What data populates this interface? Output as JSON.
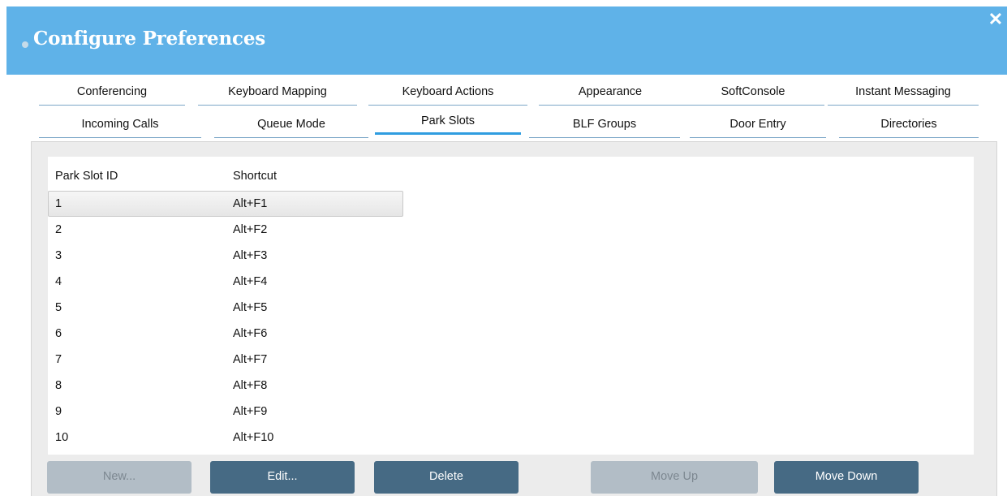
{
  "window": {
    "title": "Configure Preferences",
    "close_glyph": "✕"
  },
  "tabs_row1": [
    "Conferencing",
    "Keyboard Mapping",
    "Keyboard Actions",
    "Appearance",
    "SoftConsole",
    "Instant Messaging"
  ],
  "tabs_row2": [
    "Incoming Calls",
    "Queue Mode",
    "Park Slots",
    "BLF Groups",
    "Door Entry",
    "Directories"
  ],
  "active_tab": "Park Slots",
  "table": {
    "headers": [
      "Park Slot ID",
      "Shortcut"
    ],
    "rows": [
      [
        "1",
        "Alt+F1"
      ],
      [
        "2",
        "Alt+F2"
      ],
      [
        "3",
        "Alt+F3"
      ],
      [
        "4",
        "Alt+F4"
      ],
      [
        "5",
        "Alt+F5"
      ],
      [
        "6",
        "Alt+F6"
      ],
      [
        "7",
        "Alt+F7"
      ],
      [
        "8",
        "Alt+F8"
      ],
      [
        "9",
        "Alt+F9"
      ],
      [
        "10",
        "Alt+F10"
      ]
    ],
    "selected_row": 0
  },
  "buttons": {
    "new": {
      "label": "New...",
      "enabled": false
    },
    "edit": {
      "label": "Edit...",
      "enabled": true
    },
    "delete": {
      "label": "Delete",
      "enabled": true
    },
    "move_up": {
      "label": "Move Up",
      "enabled": false
    },
    "move_down": {
      "label": "Move Down",
      "enabled": true
    }
  },
  "colors": {
    "titlebar": "#5fb2e8",
    "tab_underline": "#7ba6c7",
    "active_tab_underline": "#2f9de0",
    "button": "#466a84",
    "button_disabled": "#b2bdc6",
    "panel": "#ececec"
  }
}
